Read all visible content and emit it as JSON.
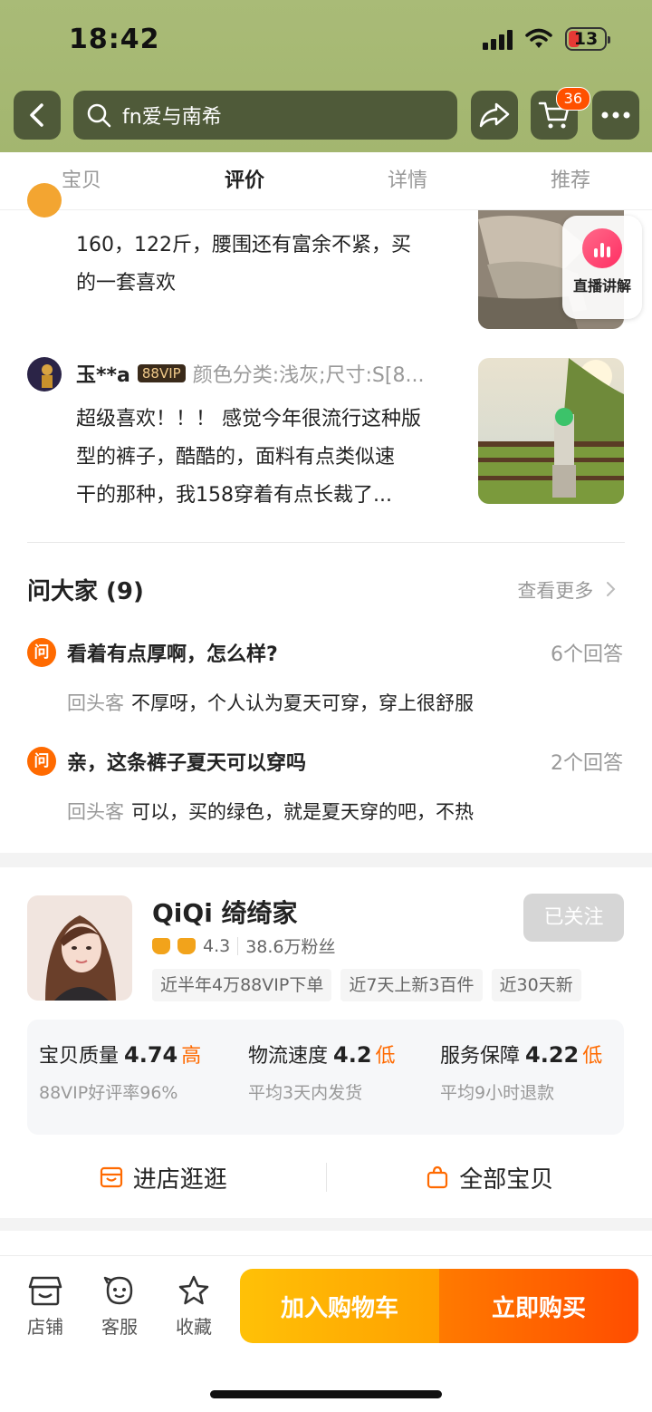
{
  "status": {
    "time": "18:42",
    "battery": "13"
  },
  "search": {
    "query": "fn爱与南希"
  },
  "cart": {
    "count": "36"
  },
  "tabs": [
    "宝贝",
    "评价",
    "详情",
    "推荐"
  ],
  "live": {
    "label": "直播讲解"
  },
  "reviews": [
    {
      "text_line1": "160，122斤，腰围还有富余不紧，买",
      "text_line2": "的一套喜欢"
    },
    {
      "user": "玉**a",
      "vip": "88VIP",
      "spec": "颜色分类:浅灰;尺寸:S[8...",
      "text_line1": "超级喜欢！！！ 感觉今年很流行这种版",
      "text_line2": "型的裤子，酷酷的，面料有点类似速",
      "text_line3": "干的那种，我158穿着有点长裁了..."
    }
  ],
  "qa": {
    "title": "问大家 (9)",
    "more": "查看更多",
    "icon_text": "问",
    "items": [
      {
        "question": "看着有点厚啊，怎么样?",
        "count": "6个回答",
        "who": "回头客",
        "answer": "不厚呀，个人认为夏天可穿，穿上很舒服"
      },
      {
        "question": "亲，这条裤子夏天可以穿吗",
        "count": "2个回答",
        "who": "回头客",
        "answer": "可以，买的绿色，就是夏天穿的吧，不热"
      }
    ]
  },
  "shop": {
    "name": "QiQi 绮绮家",
    "follow": "已关注",
    "rating": "4.3",
    "fans": "38.6万粉丝",
    "tags": [
      "近半年4万88VIP下单",
      "近7天上新3百件",
      "近30天新"
    ],
    "scores": [
      {
        "label": "宝贝质量",
        "value": "4.74",
        "level": "高",
        "sub": "88VIP好评率96%"
      },
      {
        "label": "物流速度",
        "value": "4.2",
        "level": "低",
        "sub": "平均3天内发货"
      },
      {
        "label": "服务保障",
        "value": "4.22",
        "level": "低",
        "sub": "平均9小时退款"
      }
    ],
    "enter": "进店逛逛",
    "all_items": "全部宝贝"
  },
  "bottom": {
    "store": "店铺",
    "service": "客服",
    "favorite": "收藏",
    "add_cart": "加入购物车",
    "buy_now": "立即购买"
  },
  "colors": {
    "accent": "#ff5000",
    "header_bg": "#a3b66f",
    "cta_yellow": "#ffa000",
    "cta_orange": "#ff4d00"
  }
}
